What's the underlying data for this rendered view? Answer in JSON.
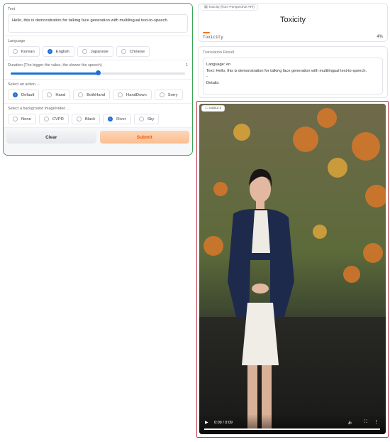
{
  "left": {
    "text_label": "Text",
    "text_value": "Hello, this is demonstration for talking face generation with multilingual text-to-speech.",
    "language_label": "Language",
    "languages": [
      {
        "label": "Korean",
        "selected": false
      },
      {
        "label": "English",
        "selected": true
      },
      {
        "label": "Japanese",
        "selected": false
      },
      {
        "label": "Chinese",
        "selected": false
      }
    ],
    "duration_label": "Duration (The bigger the value, the slower the speech)",
    "duration_value": "1",
    "duration_fraction": 0.5,
    "action_label": "Select an action ...",
    "actions": [
      {
        "label": "Default",
        "selected": true
      },
      {
        "label": "Hand",
        "selected": false
      },
      {
        "label": "BothHand",
        "selected": false
      },
      {
        "label": "HandDown",
        "selected": false
      },
      {
        "label": "Sorry",
        "selected": false
      }
    ],
    "bg_label": "Select a background image/video ...",
    "backgrounds": [
      {
        "label": "None",
        "selected": false
      },
      {
        "label": "CVPR",
        "selected": false
      },
      {
        "label": "Black",
        "selected": false
      },
      {
        "label": "River",
        "selected": true
      },
      {
        "label": "Sky",
        "selected": false
      }
    ],
    "clear_label": "Clear",
    "submit_label": "Submit"
  },
  "toxicity": {
    "tag": "Toxicity (from Perspective API)",
    "title": "Toxicity",
    "row_label": "Toxicity",
    "row_value": "4%",
    "fraction": 0.04,
    "bar_color": "#f97316"
  },
  "translation": {
    "label": "Translation Result",
    "lines": [
      "Language: en",
      "Text: Hello, this is demonstration for talking face generation with multilingual text-to-speech.",
      "-",
      "Details:"
    ]
  },
  "video": {
    "tag": "output 2",
    "time": "0:09 / 0:09",
    "progress": 1.0
  }
}
